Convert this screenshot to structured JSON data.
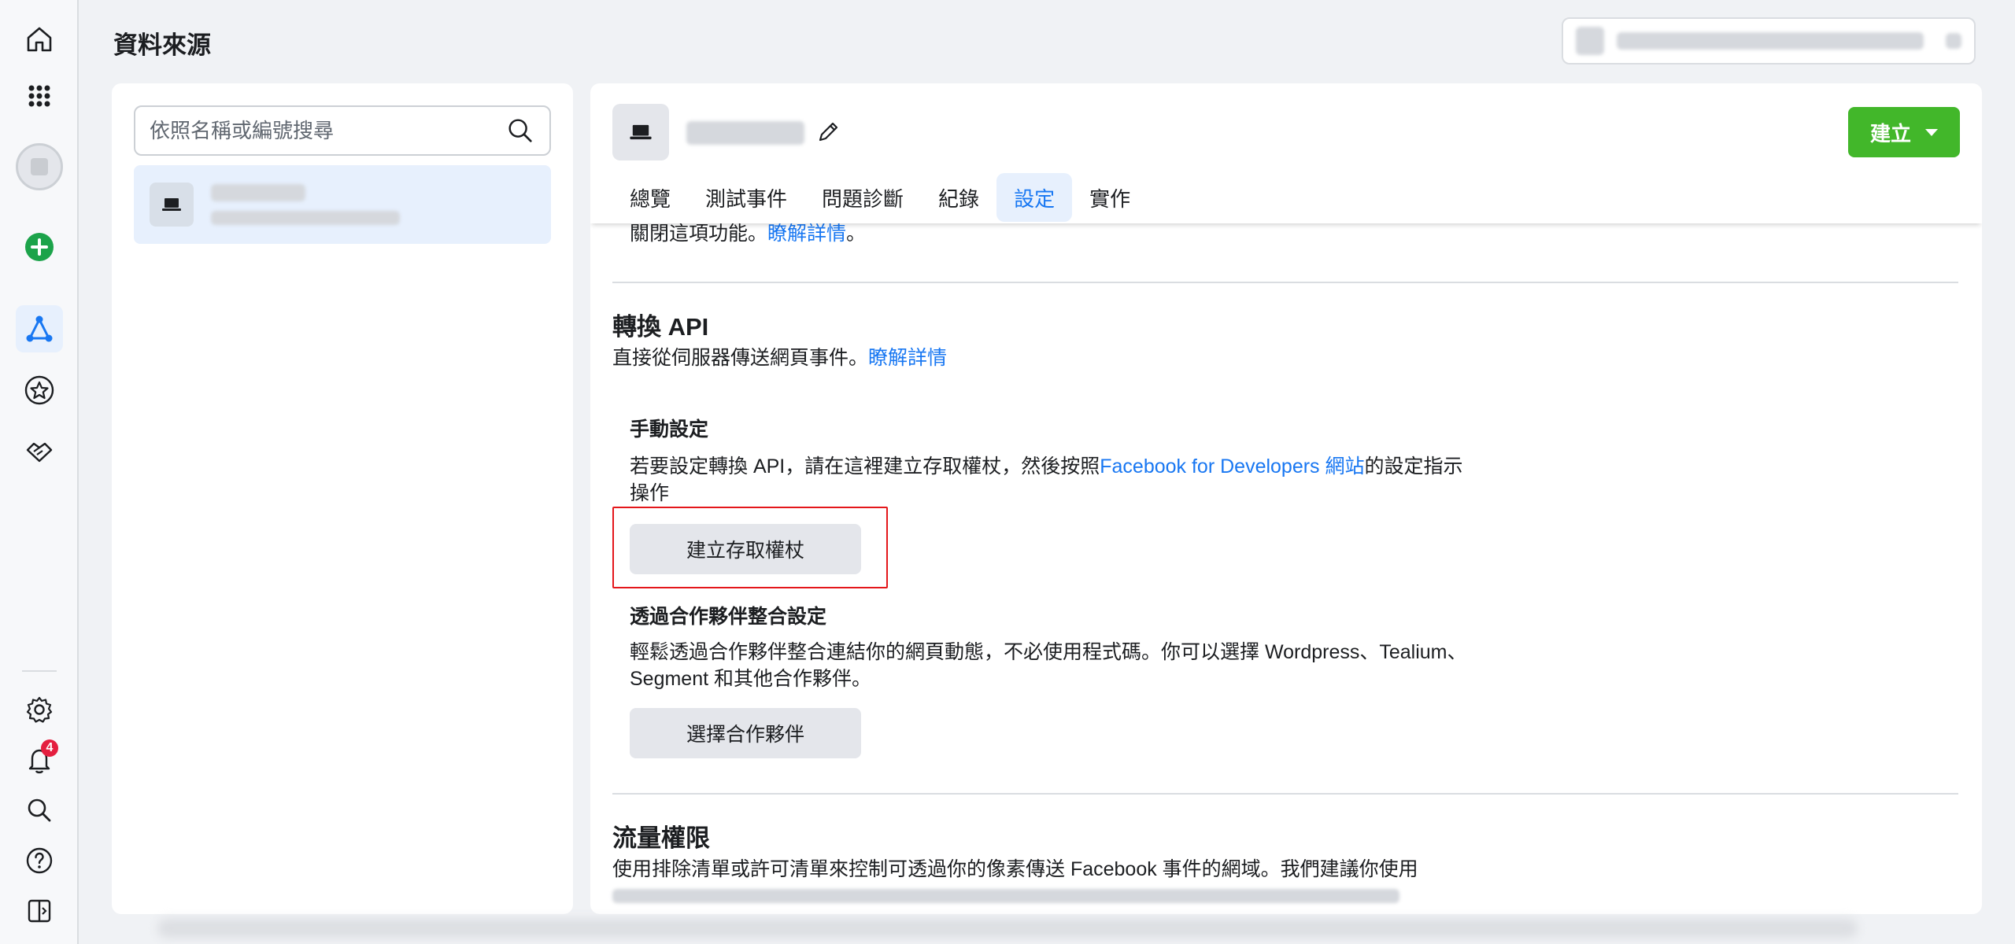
{
  "page": {
    "title": "資料來源"
  },
  "colors": {
    "accent": "#1877f2",
    "create_button": "#42b72a",
    "notification_badge": "#e41e3f",
    "highlight_box": "#e4171b"
  },
  "rail": {
    "items": [
      {
        "name": "home-icon"
      },
      {
        "name": "grid-menu-icon"
      },
      {
        "name": "account-avatar"
      },
      {
        "name": "add-icon"
      },
      {
        "name": "events-manager-icon"
      },
      {
        "name": "star-icon"
      },
      {
        "name": "partner-handshake-icon"
      },
      {
        "name": "settings-icon"
      },
      {
        "name": "notifications-icon"
      },
      {
        "name": "search-icon"
      },
      {
        "name": "help-icon"
      },
      {
        "name": "panel-toggle-icon"
      }
    ],
    "notifications_badge": "4"
  },
  "left_panel": {
    "search": {
      "placeholder": "依照名稱或編號搜尋",
      "value": ""
    }
  },
  "right_panel": {
    "create_label": "建立",
    "tabs": [
      {
        "label": "總覽"
      },
      {
        "label": "測試事件"
      },
      {
        "label": "問題診斷"
      },
      {
        "label": "紀錄"
      },
      {
        "label": "設定",
        "active": true
      },
      {
        "label": "實作"
      }
    ],
    "truncated_line": {
      "text": "關閉這項功能。",
      "link": "瞭解詳情",
      "suffix": "。"
    },
    "conversions_api": {
      "title": "轉換 API",
      "desc": "直接從伺服器傳送網頁事件。",
      "learn_more": "瞭解詳情",
      "manual": {
        "title": "手動設定",
        "text_before": "若要設定轉換 API，請在這裡建立存取權杖，然後按照",
        "link": "Facebook for Developers 網站",
        "text_after": "的設定指示",
        "text_line2": "操作",
        "button": "建立存取權杖"
      },
      "partner": {
        "title": "透過合作夥伴整合設定",
        "line1": "輕鬆透過合作夥伴整合連結你的網頁動態，不必使用程式碼。你可以選擇 Wordpress、Tealium、",
        "line2": "Segment 和其他合作夥伴。",
        "button": "選擇合作夥伴"
      }
    },
    "traffic_permissions": {
      "title": "流量權限",
      "line1": "使用排除清單或許可清單來控制可透過你的像素傳送 Facebook 事件的網域。我們建議你使用"
    }
  }
}
